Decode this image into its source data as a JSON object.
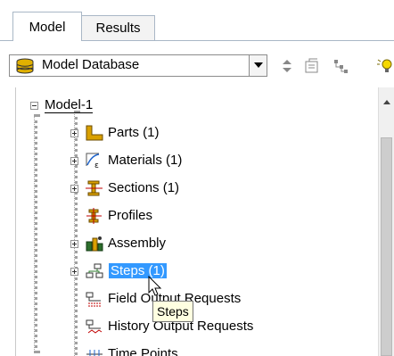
{
  "tabs": [
    {
      "label": "Model",
      "active": true
    },
    {
      "label": "Results",
      "active": false
    }
  ],
  "toolbar": {
    "database_label": "Model Database",
    "icons": [
      "database-icon",
      "up-down-arrows-icon",
      "collapse-tree-icon",
      "expand-tree-icon",
      "lightbulb-icon"
    ]
  },
  "tree": {
    "root": {
      "label": "Model-1",
      "expanded": true
    },
    "items": [
      {
        "label": "Parts (1)",
        "icon": "parts-icon",
        "expandable": true
      },
      {
        "label": "Materials (1)",
        "icon": "materials-icon",
        "expandable": true
      },
      {
        "label": "Sections (1)",
        "icon": "sections-icon",
        "expandable": true
      },
      {
        "label": "Profiles",
        "icon": "profiles-icon",
        "expandable": false
      },
      {
        "label": "Assembly",
        "icon": "assembly-icon",
        "expandable": true
      },
      {
        "label": "Steps (1)",
        "icon": "steps-icon",
        "expandable": true,
        "selected": true
      },
      {
        "label": "Field Output Requests",
        "icon": "field-output-icon",
        "expandable": false
      },
      {
        "label": "History Output Requests",
        "icon": "history-output-icon",
        "expandable": false
      },
      {
        "label": "Time Points",
        "icon": "time-points-icon",
        "expandable": false
      }
    ]
  },
  "tooltip": {
    "text": "Steps"
  },
  "colors": {
    "selection": "#3399ff",
    "tooltip_bg": "#ffffe1"
  }
}
